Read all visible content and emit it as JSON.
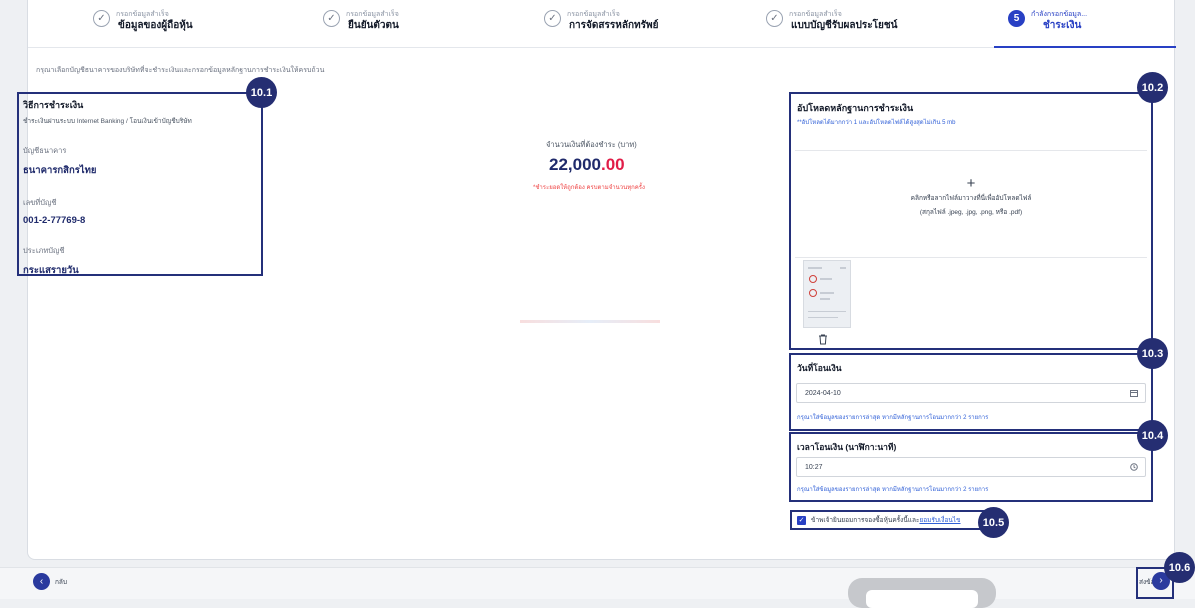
{
  "stepper": {
    "steps": [
      {
        "small": "กรอกข้อมูลสำเร็จ",
        "label": "ข้อมูลของผู้ถือหุ้น",
        "icon": "check-circle-icon"
      },
      {
        "small": "กรอกข้อมูลสำเร็จ",
        "label": "ยืนยันตัวตน",
        "icon": "check-circle-icon"
      },
      {
        "small": "กรอกข้อมูลสำเร็จ",
        "label": "การจัดสรรหลักทรัพย์",
        "icon": "check-circle-icon"
      },
      {
        "small": "กรอกข้อมูลสำเร็จ",
        "label": "แบบบัญชีรับผลประโยชน์",
        "icon": "check-circle-icon"
      },
      {
        "small": "กำลังกรอกข้อมูล...",
        "label": "ชำระเงิน",
        "number": "5"
      }
    ]
  },
  "instruction": "กรุณาเลือกบัญชีธนาคารของบริษัทที่จะชำระเงินและกรอกข้อมูลหลักฐานการชำระเงินให้ครบถ้วน",
  "payment_method": {
    "title": "วิธีการชำระเงิน",
    "subtitle": "ชำระเงินผ่านระบบ Internet Banking / โอนเงินเข้าบัญชีบริษัท",
    "bank_label": "บัญชีธนาคาร",
    "bank_value": "ธนาคารกสิกรไทย",
    "account_no_label": "เลขที่บัญชี",
    "account_no_value": "001-2-77769-8",
    "account_type_label": "ประเภทบัญชี",
    "account_type_value": "กระแสรายวัน"
  },
  "amount": {
    "label": "จำนวนเงินที่ต้องชำระ (บาท)",
    "integer": "22,000",
    "decimal": ".00",
    "note": "*ชำระยอดให้ถูกต้อง ครบตามจำนวนทุกครั้ง"
  },
  "upload": {
    "title": "อัปโหลดหลักฐานการชำระเงิน",
    "note": "**อัปโหลดได้มากกว่า 1 และอัปโหลดไฟล์ได้สูงสุดไม่เกิน 5 mb",
    "plus": "+",
    "drop_text": "คลิกหรือลากไฟล์มาวางที่นี่เพื่ออัปโหลดไฟล์",
    "drop_formats": "(สกุลไฟล์ .jpeg, .jpg, .png, หรือ .pdf)",
    "delete_icon": "trash-icon"
  },
  "transfer_date": {
    "title": "วันที่โอนเงิน",
    "value": "2024-04-10",
    "icon": "calendar-icon",
    "note": "กรุณาใส่ข้อมูลของรายการล่าสุด หากมีหลักฐานการโอนมากกว่า 2 รายการ"
  },
  "transfer_time": {
    "title": "เวลาโอนเงิน (นาฬิกา:นาที)",
    "value": "10:27",
    "icon": "clock-icon",
    "note": "กรุณาใส่ข้อมูลของรายการล่าสุด หากมีหลักฐานการโอนมากกว่า 2 รายการ"
  },
  "consent": {
    "text": "ข้าพเจ้ายินยอมการจองซื้อหุ้นครั้งนี้และ",
    "link": "ยอมรับเงื่อนไข",
    "checked": true
  },
  "badges": [
    "10.1",
    "10.2",
    "10.3",
    "10.4",
    "10.5",
    "10.6"
  ],
  "footer": {
    "back_label": "กลับ",
    "next_label": "ส่งข้อมูล"
  },
  "colors": {
    "primary": "#2840c4",
    "annotation": "#24307a",
    "amount_decimal": "#e11d48",
    "link": "#2f5fd7"
  }
}
